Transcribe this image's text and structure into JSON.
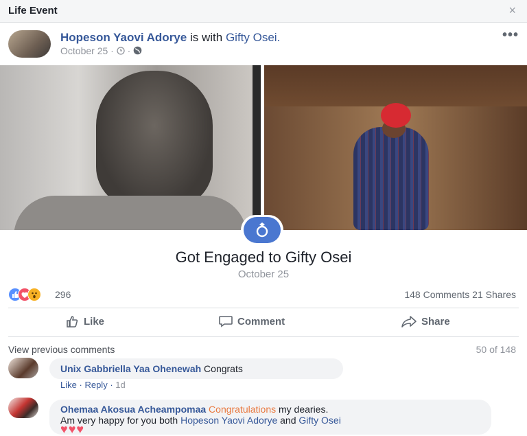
{
  "dialog": {
    "title": "Life Event",
    "close_icon": "×"
  },
  "post": {
    "author": "Hopeson Yaovi Adorye",
    "with_text": "is with",
    "tagged": "Gifty Osei.",
    "date": "October 25",
    "separator": "·",
    "more_icon": "•••"
  },
  "event": {
    "title": "Got Engaged to Gifty Osei",
    "date": "October 25"
  },
  "stats": {
    "reactions_count": "296",
    "comments": "148 Comments",
    "shares": "21 Shares"
  },
  "actions": {
    "like": "Like",
    "comment": "Comment",
    "share": "Share"
  },
  "comments_section": {
    "view_previous": "View previous comments",
    "pager": "50 of 148",
    "items": [
      {
        "author": "Unix Gabbriella Yaa Ohenewah",
        "text": "Congrats",
        "like_label": "Like",
        "reply_label": "Reply",
        "sep": "·",
        "time": "1d"
      },
      {
        "author": "Ohemaa Akosua Acheampomaa",
        "highlight": "Congratulations",
        "text1": "my dearies.",
        "text2_pre": "Am very happy for you both",
        "link1": "Hopeson Yaovi Adorye",
        "and": "and",
        "link2": "Gifty Osei",
        "hearts": "♥♥♥"
      }
    ]
  },
  "colors": {
    "brand_blue": "#365899",
    "like_blue": "#5890ff",
    "love_red": "#f25268",
    "wow_yellow": "#f7b125",
    "ring_badge": "#4a77d0"
  }
}
